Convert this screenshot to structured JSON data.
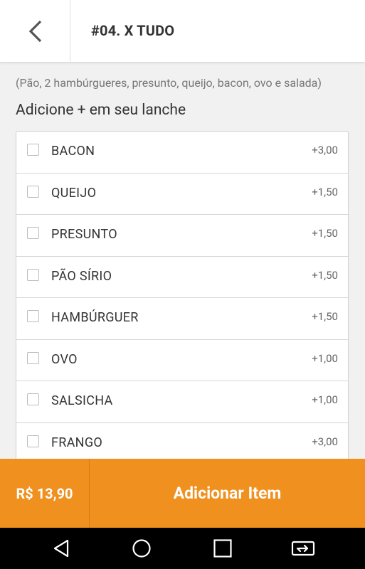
{
  "header": {
    "title": "#04. X TUDO",
    "back_icon": "chevron-left-icon"
  },
  "description": "(Pão, 2 hambúrgueres, presunto, queijo, bacon, ovo e salada)",
  "add_label": "Adicione + em seu lanche",
  "extras": [
    {
      "label": "BACON",
      "price": "+3,00",
      "checked": false
    },
    {
      "label": "QUEIJO",
      "price": "+1,50",
      "checked": false
    },
    {
      "label": "PRESUNTO",
      "price": "+1,50",
      "checked": false
    },
    {
      "label": "PÃO SÍRIO",
      "price": "+1,50",
      "checked": false
    },
    {
      "label": "HAMBÚRGUER",
      "price": "+1,50",
      "checked": false
    },
    {
      "label": "OVO",
      "price": "+1,00",
      "checked": false
    },
    {
      "label": "SALSICHA",
      "price": "+1,00",
      "checked": false
    },
    {
      "label": "FRANGO",
      "price": "+3,00",
      "checked": false
    }
  ],
  "footer": {
    "total": "R$ 13,90",
    "add_button": "Adicionar Item"
  },
  "navbar": {
    "icons": [
      "back-triangle-icon",
      "home-circle-icon",
      "recents-square-icon",
      "screen-cast-icon"
    ]
  },
  "colors": {
    "accent": "#f0901e",
    "header_bg": "#ffffff",
    "page_bg": "#f1f1f1"
  }
}
